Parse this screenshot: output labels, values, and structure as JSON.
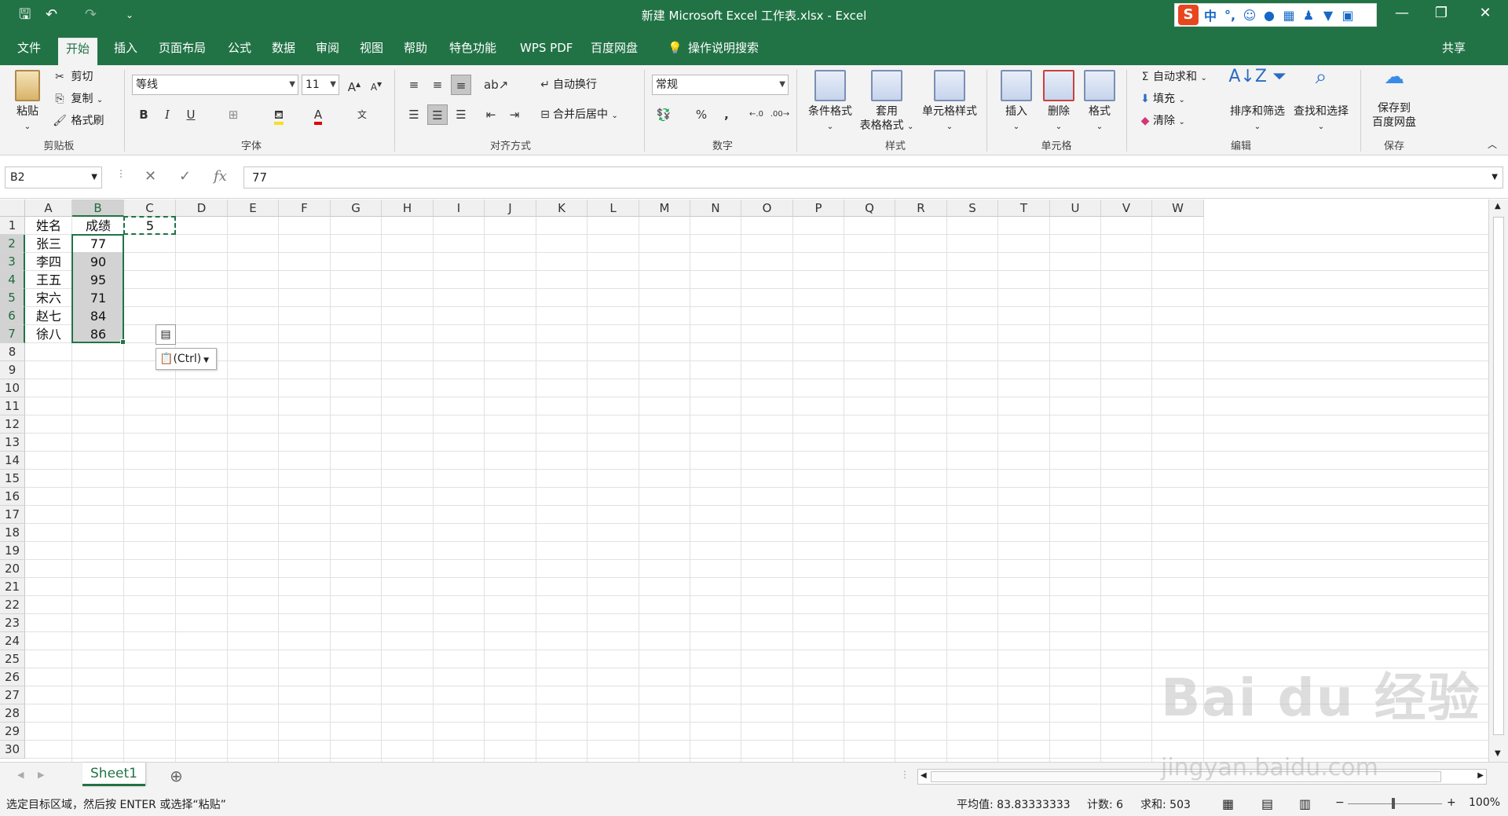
{
  "window": {
    "title": "新建 Microsoft Excel 工作表.xlsx  -  Excel",
    "min": "—",
    "restore": "❐",
    "close": "✕"
  },
  "ime": {
    "label": "中"
  },
  "quick_access": {
    "save": "🖫",
    "undo": "↶",
    "redo": "↷",
    "customize": "⌄"
  },
  "ribbon_tabs": [
    {
      "label": "文件"
    },
    {
      "label": "开始"
    },
    {
      "label": "插入"
    },
    {
      "label": "页面布局"
    },
    {
      "label": "公式"
    },
    {
      "label": "数据"
    },
    {
      "label": "审阅"
    },
    {
      "label": "视图"
    },
    {
      "label": "帮助"
    },
    {
      "label": "特色功能"
    },
    {
      "label": "WPS PDF"
    },
    {
      "label": "百度网盘"
    },
    {
      "label": "操作说明搜索"
    },
    {
      "label": "共享"
    }
  ],
  "clipboard": {
    "paste": "粘贴",
    "cut": "剪切",
    "copy": "复制",
    "format_painter": "格式刷",
    "group": "剪贴板"
  },
  "font": {
    "name": "等线",
    "size": "11",
    "group": "字体",
    "bold": "B",
    "italic": "I",
    "underline": "U",
    "grow": "A",
    "shrink": "A",
    "color_letter": "A"
  },
  "alignment": {
    "wrap": "自动换行",
    "merge": "合并后居中",
    "group": "对齐方式"
  },
  "number": {
    "format": "常规",
    "percent": "%",
    "comma": ",",
    "group": "数字"
  },
  "styles": {
    "conditional": "条件格式",
    "table_line1": "套用",
    "table_line2": "表格格式",
    "cell_styles": "单元格样式",
    "group": "样式"
  },
  "cells": {
    "insert": "插入",
    "delete": "删除",
    "format": "格式",
    "group": "单元格"
  },
  "editing": {
    "autosum": "自动求和",
    "fill": "填充",
    "clear": "清除",
    "sort": "排序和筛选",
    "find": "查找和选择",
    "group": "编辑"
  },
  "save_group": {
    "line1": "保存到",
    "line2": "百度网盘",
    "group": "保存"
  },
  "formula_bar": {
    "name_box": "B2",
    "value": "77",
    "fx": "fx"
  },
  "columns": [
    "A",
    "B",
    "C",
    "D",
    "E",
    "F",
    "G",
    "H",
    "I",
    "J",
    "K",
    "L",
    "M",
    "N",
    "O",
    "P",
    "Q",
    "R",
    "S",
    "T",
    "U",
    "V",
    "W"
  ],
  "rows": [
    "1",
    "2",
    "3",
    "4",
    "5",
    "6",
    "7",
    "8",
    "9",
    "10",
    "11",
    "12",
    "13",
    "14",
    "15",
    "16",
    "17",
    "18",
    "19",
    "20",
    "21",
    "22",
    "23",
    "24",
    "25",
    "26",
    "27",
    "28",
    "29",
    "30"
  ],
  "cells_data": {
    "A1": "姓名",
    "B1": "成绩",
    "C1": "5",
    "A2": "张三",
    "B2": "77",
    "A3": "李四",
    "B3": "90",
    "A4": "王五",
    "B4": "95",
    "A5": "宋六",
    "B5": "71",
    "A6": "赵七",
    "B6": "84",
    "A7": "徐八",
    "B7": "86"
  },
  "paste_options": {
    "label": "(Ctrl)"
  },
  "sheet": {
    "name": "Sheet1",
    "add": "⊕"
  },
  "status": {
    "message": "选定目标区域，然后按 ENTER 或选择“粘贴”",
    "average": "平均值: 83.83333333",
    "count": "计数: 6",
    "sum": "求和: 503",
    "zoom": "100%"
  },
  "watermark": {
    "brand": "Bai du 经验",
    "url": "jingyan.baidu.com"
  }
}
